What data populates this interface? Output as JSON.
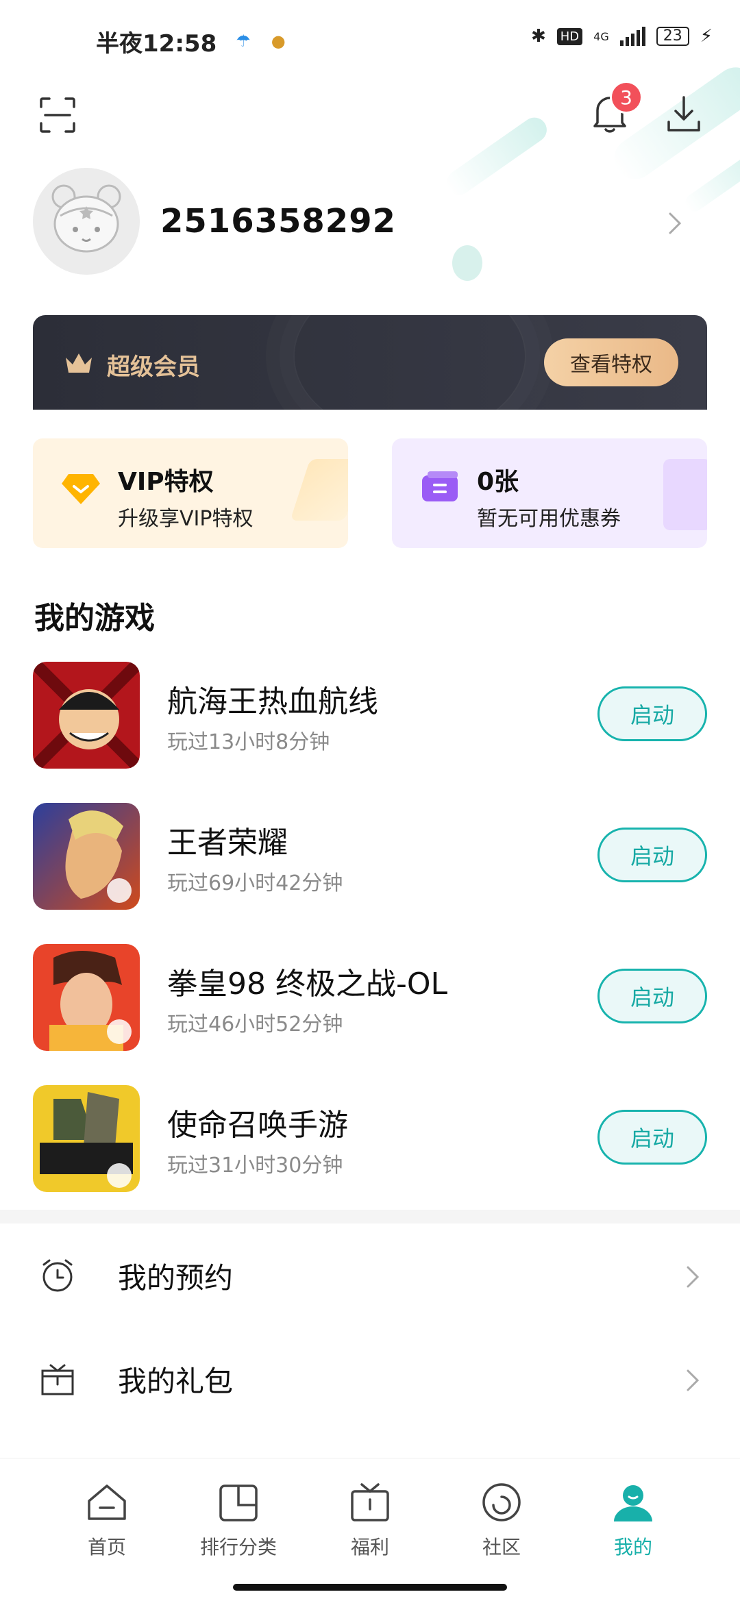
{
  "status_bar": {
    "time": "半夜12:58",
    "network": "4G",
    "battery": "23"
  },
  "header": {
    "notification_count": "3",
    "user_id": "2516358292"
  },
  "vip_banner": {
    "title": "超级会员",
    "button_label": "查看特权"
  },
  "perks": {
    "vip": {
      "title": "VIP特权",
      "subtitle": "升级享VIP特权"
    },
    "coupon": {
      "title": "0张",
      "subtitle": "暂无可用优惠券"
    }
  },
  "my_games": {
    "title": "我的游戏",
    "launch_label": "启动",
    "items": [
      {
        "name": "航海王热血航线",
        "played": "玩过13小时8分钟"
      },
      {
        "name": "王者荣耀",
        "played": "玩过69小时42分钟"
      },
      {
        "name": "拳皇98 终极之战-OL",
        "played": "玩过46小时52分钟"
      },
      {
        "name": "使命召唤手游",
        "played": "玩过31小时30分钟"
      }
    ]
  },
  "menu": {
    "reservations": "我的预约",
    "gifts": "我的礼包"
  },
  "tabbar": {
    "items": [
      {
        "label": "首页"
      },
      {
        "label": "排行分类"
      },
      {
        "label": "福利"
      },
      {
        "label": "社区"
      },
      {
        "label": "我的"
      }
    ],
    "active": "我的"
  },
  "colors": {
    "accent": "#17b3ad",
    "badge": "#f2505a",
    "vip_gold": "#e5c298"
  }
}
